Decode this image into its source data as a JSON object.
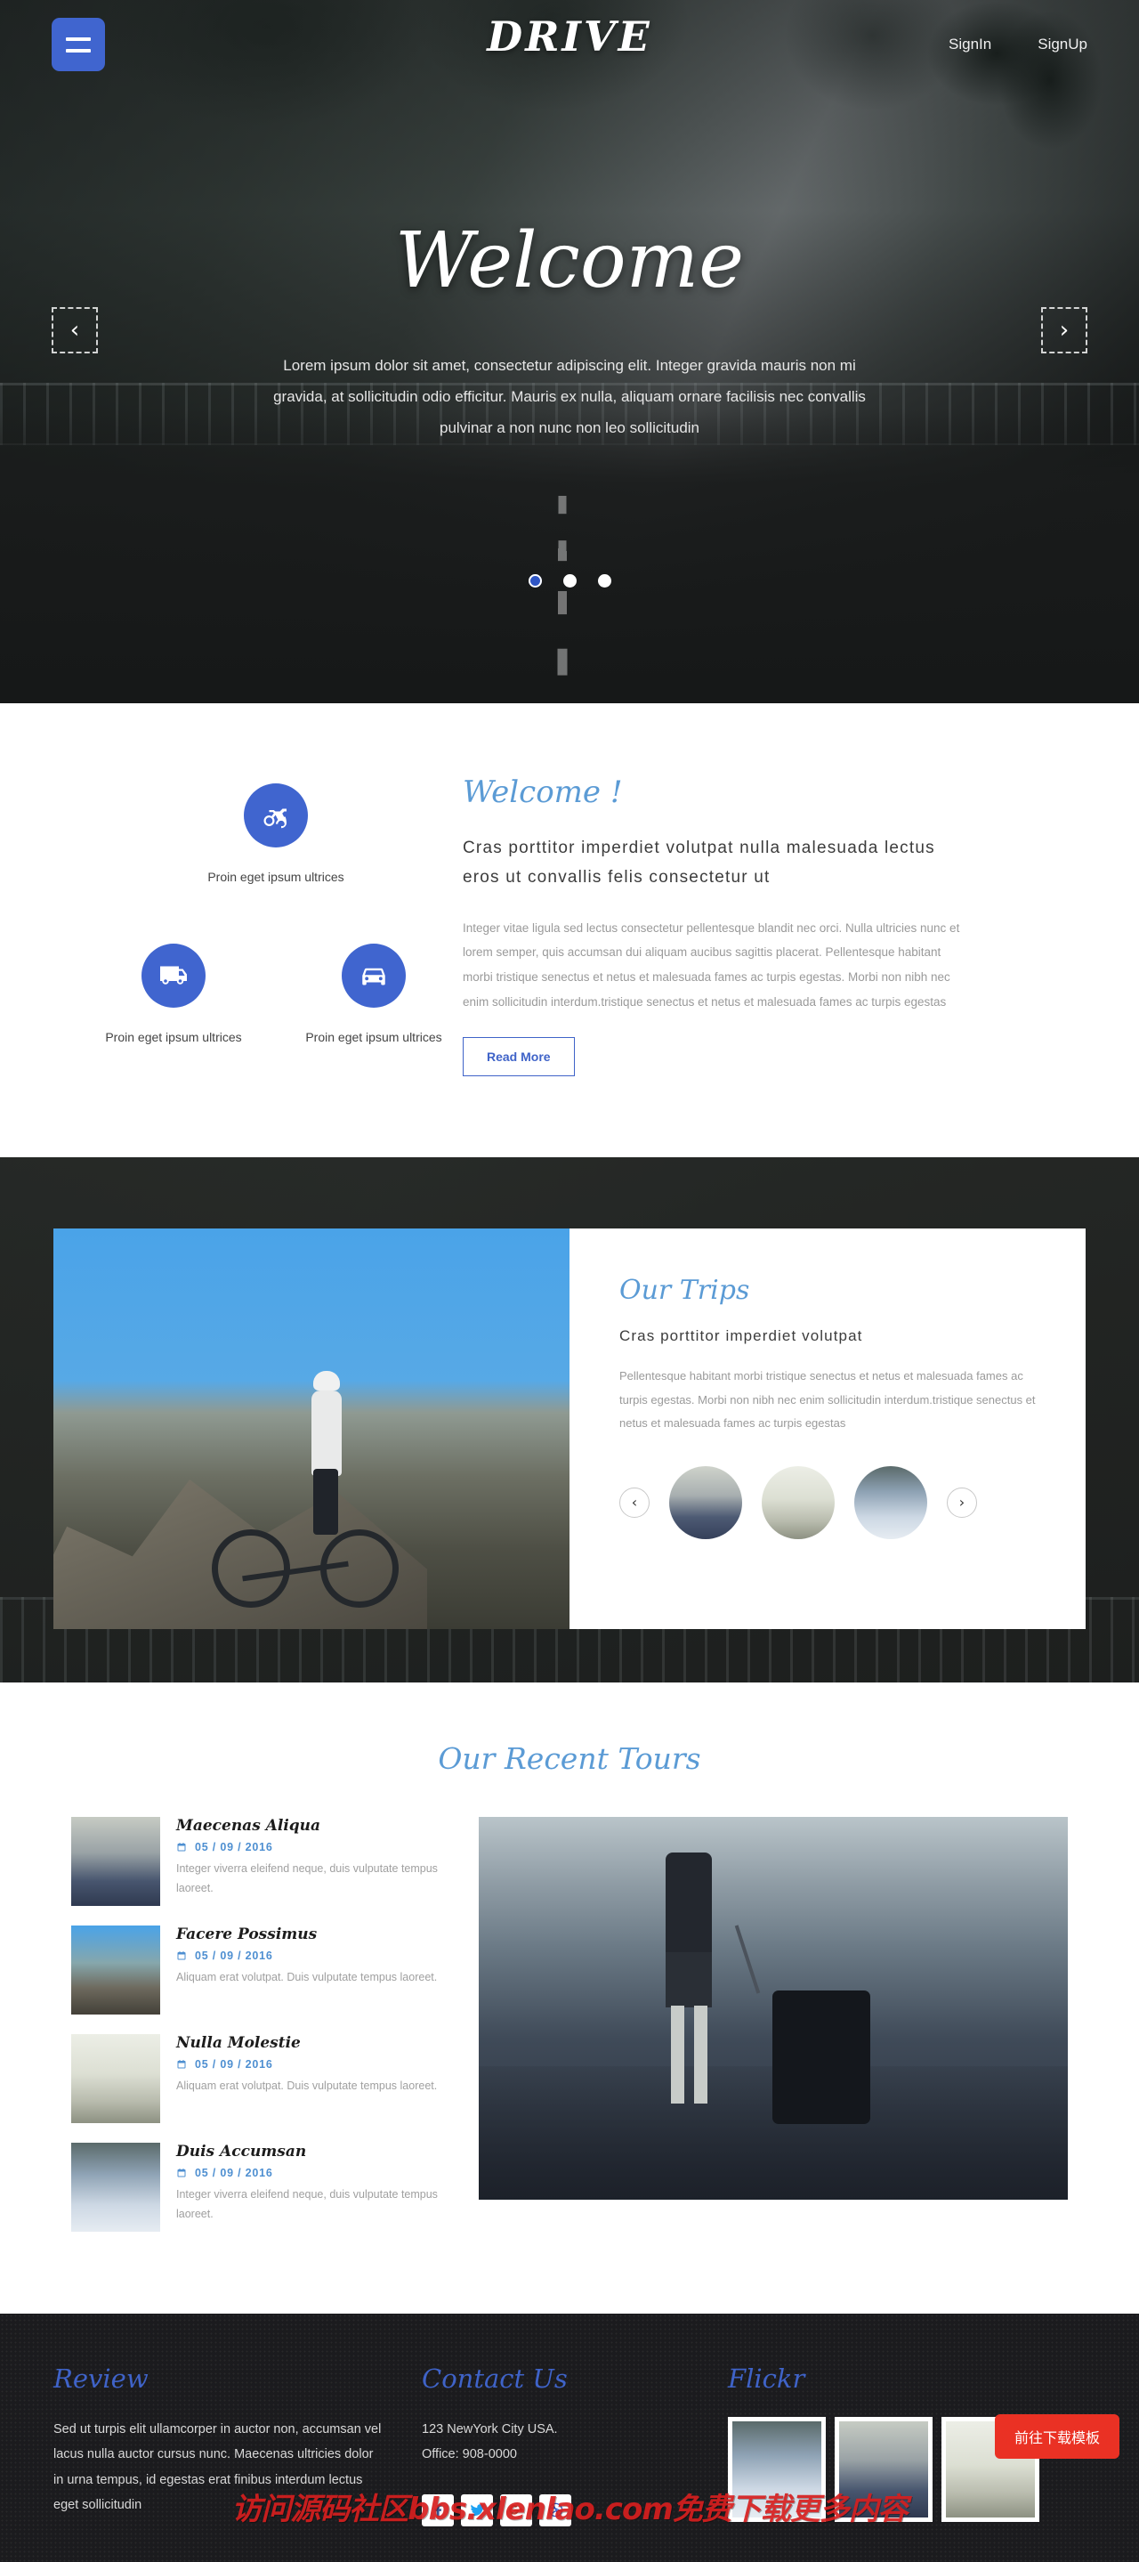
{
  "header": {
    "brand": "DRIVE",
    "menu_icon": "hamburger-icon",
    "nav": [
      {
        "label": "SignIn"
      },
      {
        "label": "SignUp"
      }
    ]
  },
  "hero": {
    "title": "Welcome",
    "subtitle": "Lorem ipsum dolor sit amet, consectetur adipiscing elit. Integer gravida mauris non mi gravida, at sollicitudin odio efficitur. Mauris ex nulla, aliquam ornare facilisis nec convallis pulvinar a non nunc non leo sollicitudin",
    "prev_label": "‹",
    "next_label": "›",
    "dots": [
      {
        "active": true
      },
      {
        "active": false
      },
      {
        "active": false
      }
    ]
  },
  "welcome": {
    "features": [
      {
        "icon": "motorcycle-icon",
        "label": "Proin eget ipsum ultrices"
      },
      {
        "icon": "truck-icon",
        "label": "Proin eget ipsum ultrices"
      },
      {
        "icon": "car-icon",
        "label": "Proin eget ipsum ultrices"
      }
    ],
    "heading": "Welcome !",
    "lead": "Cras porttitor imperdiet volutpat nulla malesuada lectus eros ut convallis felis consectetur ut",
    "body": "Integer vitae ligula sed lectus consectetur pellentesque blandit nec orci. Nulla ultricies nunc et lorem semper, quis accumsan dui aliquam aucibus sagittis placerat. Pellentesque habitant morbi tristique senectus et netus et malesuada fames ac turpis egestas. Morbi non nibh nec enim sollicitudin interdum.tristique senectus et netus et malesuada fames ac turpis egestas",
    "button": "Read More"
  },
  "trips": {
    "heading": "Our Trips",
    "subtitle": "Cras porttitor imperdiet volutpat",
    "body": "Pellentesque habitant morbi tristique senectus et netus et malesuada fames ac turpis egestas. Morbi non nibh nec enim sollicitudin interdum.tristique senectus et netus et malesuada fames ac turpis egestas",
    "prev_label": "‹",
    "next_label": "›",
    "thumbs": [
      {
        "name": "traveler-with-suitcase-thumb"
      },
      {
        "name": "photographer-in-hat-thumb"
      },
      {
        "name": "snowmobile-riders-thumb"
      }
    ]
  },
  "tours": {
    "heading": "Our Recent Tours",
    "items": [
      {
        "title": "Maecenas Aliqua",
        "date": "05 / 09 / 2016",
        "desc": "Integer viverra eleifend neque, duis vulputate tempus laoreet.",
        "thumb": "traveler-with-suitcase-thumb"
      },
      {
        "title": "Facere Possimus",
        "date": "05 / 09 / 2016",
        "desc": "Aliquam erat volutpat. Duis vulputate tempus laoreet.",
        "thumb": "mountain-biker-thumb"
      },
      {
        "title": "Nulla Molestie",
        "date": "05 / 09 / 2016",
        "desc": "Aliquam erat volutpat. Duis vulputate tempus laoreet.",
        "thumb": "photographer-in-hat-thumb"
      },
      {
        "title": "Duis Accumsan",
        "date": "05 / 09 / 2016",
        "desc": "Integer viverra eleifend neque, duis vulputate tempus laoreet.",
        "thumb": "snowmobile-riders-thumb"
      }
    ],
    "feature_image": "traveler-walking-with-suitcase"
  },
  "footer": {
    "review": {
      "heading": "Review",
      "body": "Sed ut turpis elit ullamcorper in auctor non, accumsan vel lacus nulla auctor cursus nunc. Maecenas ultricies dolor in urna tempus, id egestas erat finibus interdum lectus eget sollicitudin"
    },
    "contact": {
      "heading": "Contact Us",
      "address": "123 NewYork City USA.",
      "office": "Office: 908-0000",
      "socials": [
        {
          "name": "facebook-icon",
          "color": "#3b5998"
        },
        {
          "name": "twitter-icon",
          "color": "#1da1f2"
        },
        {
          "name": "google-plus-icon",
          "color": "#dd4b39"
        },
        {
          "name": "dribbble-icon",
          "color": "#2f56c6"
        }
      ]
    },
    "flickr": {
      "heading": "Flickr",
      "images": [
        {
          "name": "snowmobile-riders-photo"
        },
        {
          "name": "traveler-with-suitcase-photo"
        },
        {
          "name": "photographer-in-hat-photo"
        }
      ]
    },
    "download_button": "前往下载模板",
    "watermark": "访问源码社区bbs.xlenlao.com免费下载更多内容"
  },
  "colors": {
    "accent_blue": "#4065cf",
    "script_blue": "#5b9bd5",
    "footer_heading_blue": "#3f63c8",
    "date_blue": "#4e8fd1",
    "download_red": "#ea3124",
    "footer_bg": "#1b1b1e"
  }
}
